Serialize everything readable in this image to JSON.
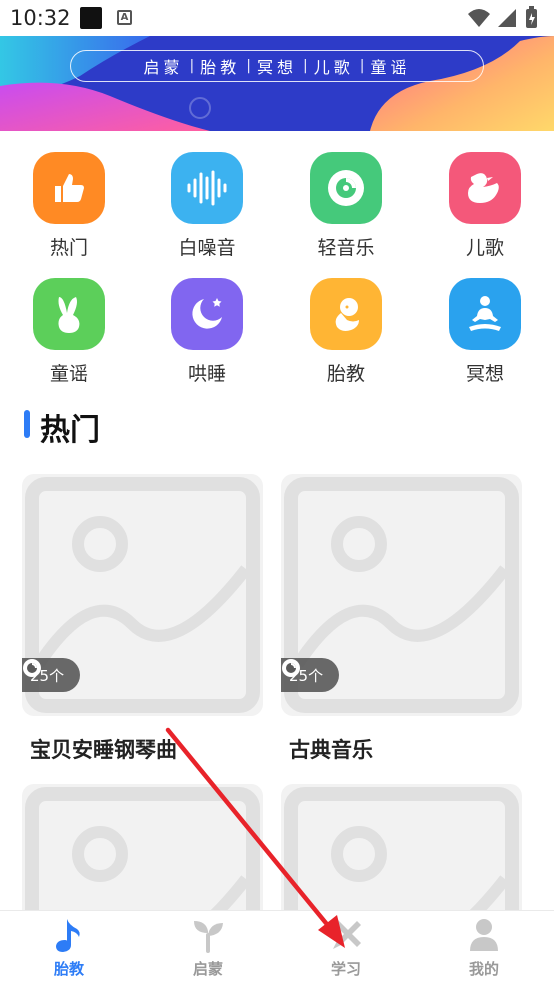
{
  "status": {
    "time": "10:32"
  },
  "banner": {
    "tags": [
      "启蒙",
      "胎教",
      "冥想",
      "儿歌",
      "童谣"
    ]
  },
  "categories": [
    {
      "label": "热门",
      "icon": "thumbs-up-icon",
      "color": "#ff8a24"
    },
    {
      "label": "白噪音",
      "icon": "sound-wave-icon",
      "color": "#3cb2f0"
    },
    {
      "label": "轻音乐",
      "icon": "music-disc-icon",
      "color": "#45c97b"
    },
    {
      "label": "儿歌",
      "icon": "duck-icon",
      "color": "#f4587a"
    },
    {
      "label": "童谣",
      "icon": "rabbit-icon",
      "color": "#5ccf5a"
    },
    {
      "label": "哄睡",
      "icon": "moon-icon",
      "color": "#8166f0"
    },
    {
      "label": "胎教",
      "icon": "fetus-icon",
      "color": "#ffb534"
    },
    {
      "label": "冥想",
      "icon": "meditation-icon",
      "color": "#2aa2ee"
    }
  ],
  "section": {
    "title": "热门"
  },
  "cards": [
    {
      "title": "宝贝安睡钢琴曲",
      "count": "25个"
    },
    {
      "title": "古典音乐",
      "count": "25个"
    },
    {
      "title": "",
      "count": ""
    },
    {
      "title": "",
      "count": ""
    }
  ],
  "nav": [
    {
      "label": "胎教",
      "icon": "music-note-icon",
      "active": true
    },
    {
      "label": "启蒙",
      "icon": "sprout-icon",
      "active": false
    },
    {
      "label": "学习",
      "icon": "pencil-ruler-icon",
      "active": false
    },
    {
      "label": "我的",
      "icon": "user-icon",
      "active": false
    }
  ],
  "colors": {
    "accent": "#2d7cf6",
    "banner_bg": "#2d3bc8",
    "annotation_arrow": "#e8232a"
  }
}
